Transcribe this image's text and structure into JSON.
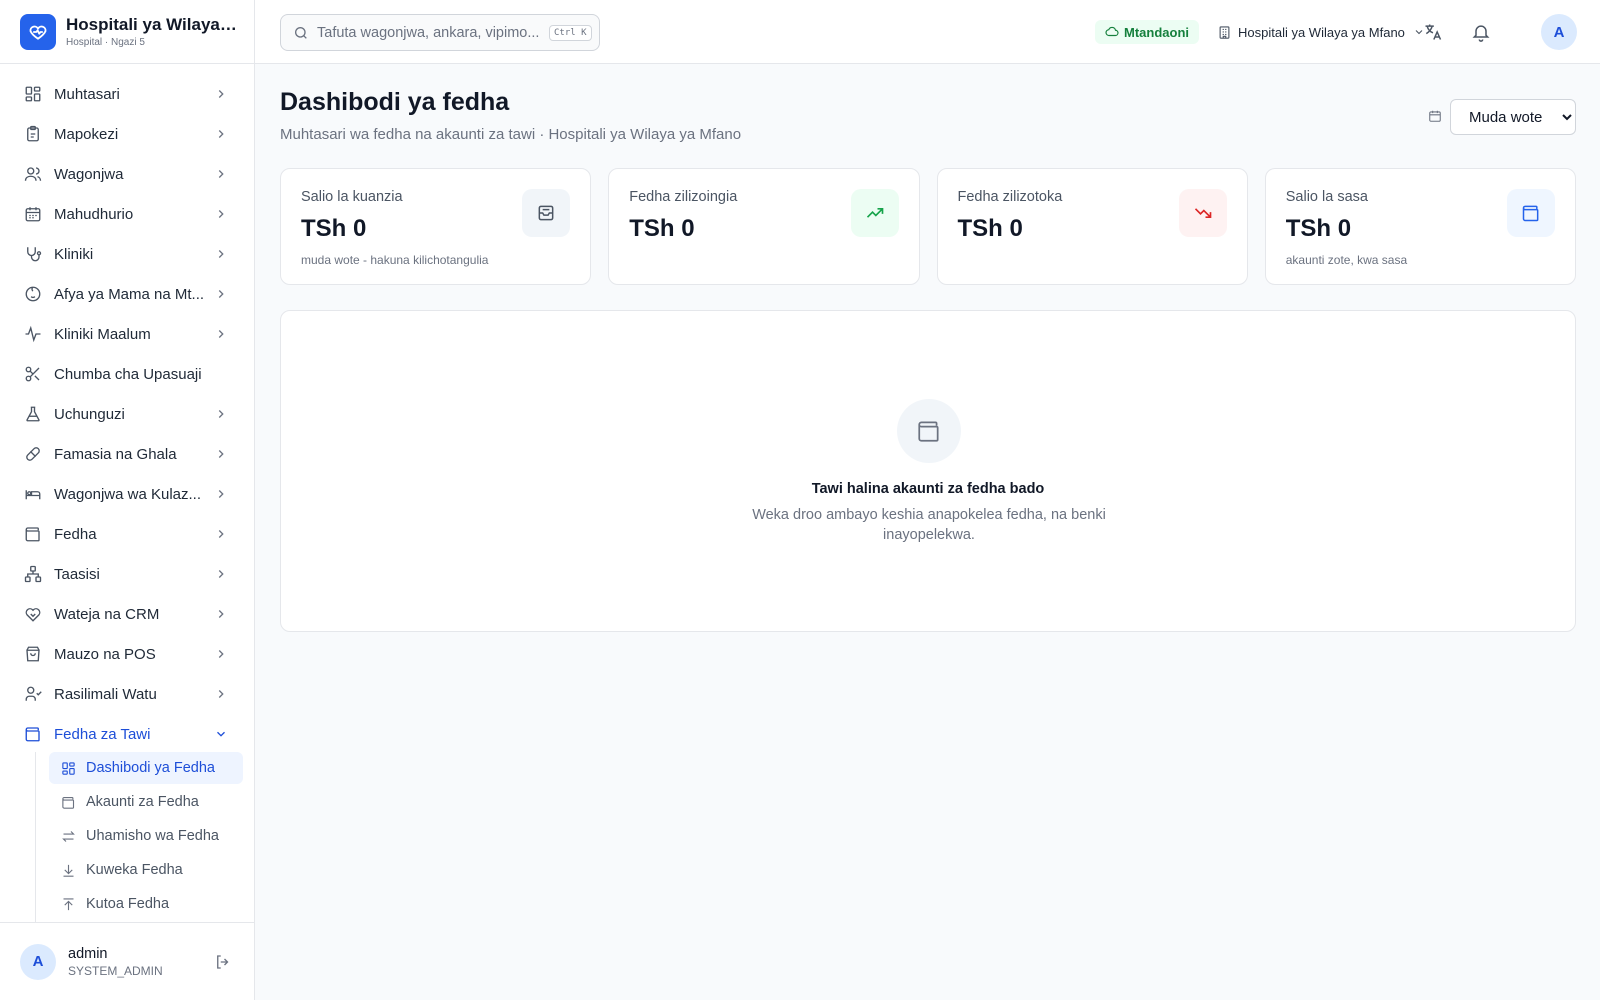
{
  "brand": {
    "title": "Hospitali ya Wilaya ...",
    "subtitle": "Hospital · Ngazi 5"
  },
  "sidebar": {
    "items": [
      {
        "label": "Muhtasari",
        "icon": "dashboard-icon",
        "has_chevron": true
      },
      {
        "label": "Mapokezi",
        "icon": "clipboard-icon",
        "has_chevron": true
      },
      {
        "label": "Wagonjwa",
        "icon": "users-icon",
        "has_chevron": true
      },
      {
        "label": "Mahudhurio",
        "icon": "calendar-icon",
        "has_chevron": true
      },
      {
        "label": "Kliniki",
        "icon": "stethoscope-icon",
        "has_chevron": true
      },
      {
        "label": "Afya ya Mama na Mt...",
        "icon": "baby-icon",
        "has_chevron": true
      },
      {
        "label": "Kliniki Maalum",
        "icon": "activity-icon",
        "has_chevron": true
      },
      {
        "label": "Chumba cha Upasuaji",
        "icon": "scissors-icon",
        "has_chevron": false
      },
      {
        "label": "Uchunguzi",
        "icon": "flask-icon",
        "has_chevron": true
      },
      {
        "label": "Famasia na Ghala",
        "icon": "pill-icon",
        "has_chevron": true
      },
      {
        "label": "Wagonjwa wa Kulaz...",
        "icon": "bed-icon",
        "has_chevron": true
      },
      {
        "label": "Fedha",
        "icon": "wallet-icon",
        "has_chevron": true
      },
      {
        "label": "Taasisi",
        "icon": "network-icon",
        "has_chevron": true
      },
      {
        "label": "Wateja na CRM",
        "icon": "handshake-icon",
        "has_chevron": true
      },
      {
        "label": "Mauzo na POS",
        "icon": "shopping-bag-icon",
        "has_chevron": true
      },
      {
        "label": "Rasilimali Watu",
        "icon": "user-group-icon",
        "has_chevron": true
      },
      {
        "label": "Fedha za Tawi",
        "icon": "wallet-icon",
        "has_chevron": true,
        "active": true,
        "expanded": true
      }
    ],
    "subitems": [
      {
        "label": "Dashibodi ya Fedha",
        "icon": "dashboard-icon",
        "active": true
      },
      {
        "label": "Akaunti za Fedha",
        "icon": "wallet-icon"
      },
      {
        "label": "Uhamisho wa Fedha",
        "icon": "transfer-icon"
      },
      {
        "label": "Kuweka Fedha",
        "icon": "download-icon"
      },
      {
        "label": "Kutoa Fedha",
        "icon": "upload-icon"
      }
    ]
  },
  "user": {
    "initial": "A",
    "name": "admin",
    "role": "SYSTEM_ADMIN"
  },
  "topbar": {
    "search_placeholder": "Tafuta wagonjwa, ankara, vipimo...",
    "search_shortcut": "Ctrl K",
    "status": "Mtandaoni",
    "branch": "Hospitali ya Wilaya ya Mfano",
    "avatar_initial": "A"
  },
  "page": {
    "title": "Dashibodi ya fedha",
    "subtitle": "Muhtasari wa fedha na akaunti za tawi · Hospitali ya Wilaya ya Mfano",
    "period_options": [
      "Muda wote"
    ],
    "period_selected": "Muda wote"
  },
  "cards": [
    {
      "label": "Salio la kuanzia",
      "value": "TSh 0",
      "note": "muda wote - hakuna kilichotangulia",
      "icon": "inbox-icon",
      "icon_bg": "#f1f5f9",
      "icon_color": "#4b5563"
    },
    {
      "label": "Fedha zilizoingia",
      "value": "TSh 0",
      "note": "",
      "icon": "trending-up-icon",
      "icon_bg": "#ecfdf3",
      "icon_color": "#16a34a"
    },
    {
      "label": "Fedha zilizotoka",
      "value": "TSh 0",
      "note": "",
      "icon": "trending-down-icon",
      "icon_bg": "#fef2f2",
      "icon_color": "#dc2626"
    },
    {
      "label": "Salio la sasa",
      "value": "TSh 0",
      "note": "akaunti zote, kwa sasa",
      "icon": "wallet-icon",
      "icon_bg": "#eff6ff",
      "icon_color": "#2563eb"
    }
  ],
  "empty_state": {
    "title": "Tawi halina akaunti za fedha bado",
    "description": "Weka droo ambayo keshia anapokelea fedha, na benki inayopelekwa."
  },
  "colors": {
    "accent": "#2563eb",
    "active_text": "#1d4ed8",
    "online": "#15803d"
  }
}
